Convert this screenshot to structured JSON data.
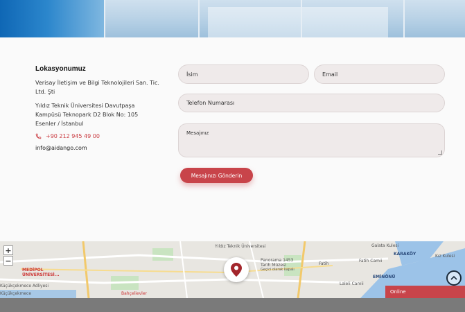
{
  "contact": {
    "heading": "Lokasyonumuz",
    "company": "Verisay İletişim ve Bilgi Teknolojileri San. Tic. Ltd. Şti",
    "address": "Yıldız Teknik Üniversitesi Davutpaşa Kampüsü Teknopark D2 Blok No: 105 Esenler / İstanbul",
    "phone": "+90 212 945 49 00",
    "email": "info@aidango.com"
  },
  "form": {
    "name_placeholder": "İsim",
    "email_placeholder": "Email",
    "phone_placeholder": "Telefon Numarası",
    "message_placeholder": "Mesajınız",
    "submit_label": "Mesajınızı Gönderin"
  },
  "map": {
    "zoom_in": "+",
    "zoom_out": "−",
    "labels": {
      "yildiz": "Yıldız Teknik Üniversitesi",
      "galata": "Galata Kulesi",
      "karakoy": "KARAKÖY",
      "kizkulesi": "Kız Kulesi",
      "panorama": "Panorama 1453 Tarih Müzesi",
      "panorama_sub": "Geçici olarak kapalı",
      "fatih": "Fatih",
      "fatih_camii": "Fatih Camii",
      "eminonu": "EMİNÖNÜ",
      "laleli": "Laleli Camii",
      "medipol": "MEDİPOL ÜNİVERSİTESİ...",
      "kucukcekmece_adliye": "Küçükçekmece Adliyesi",
      "kucukcekmece": "Küçükçekmece",
      "bahcelievler": "Bahçelievler"
    }
  },
  "chat": {
    "status": "Online"
  },
  "colors": {
    "accent": "#c8444a",
    "footer": "#7a7a7a"
  }
}
